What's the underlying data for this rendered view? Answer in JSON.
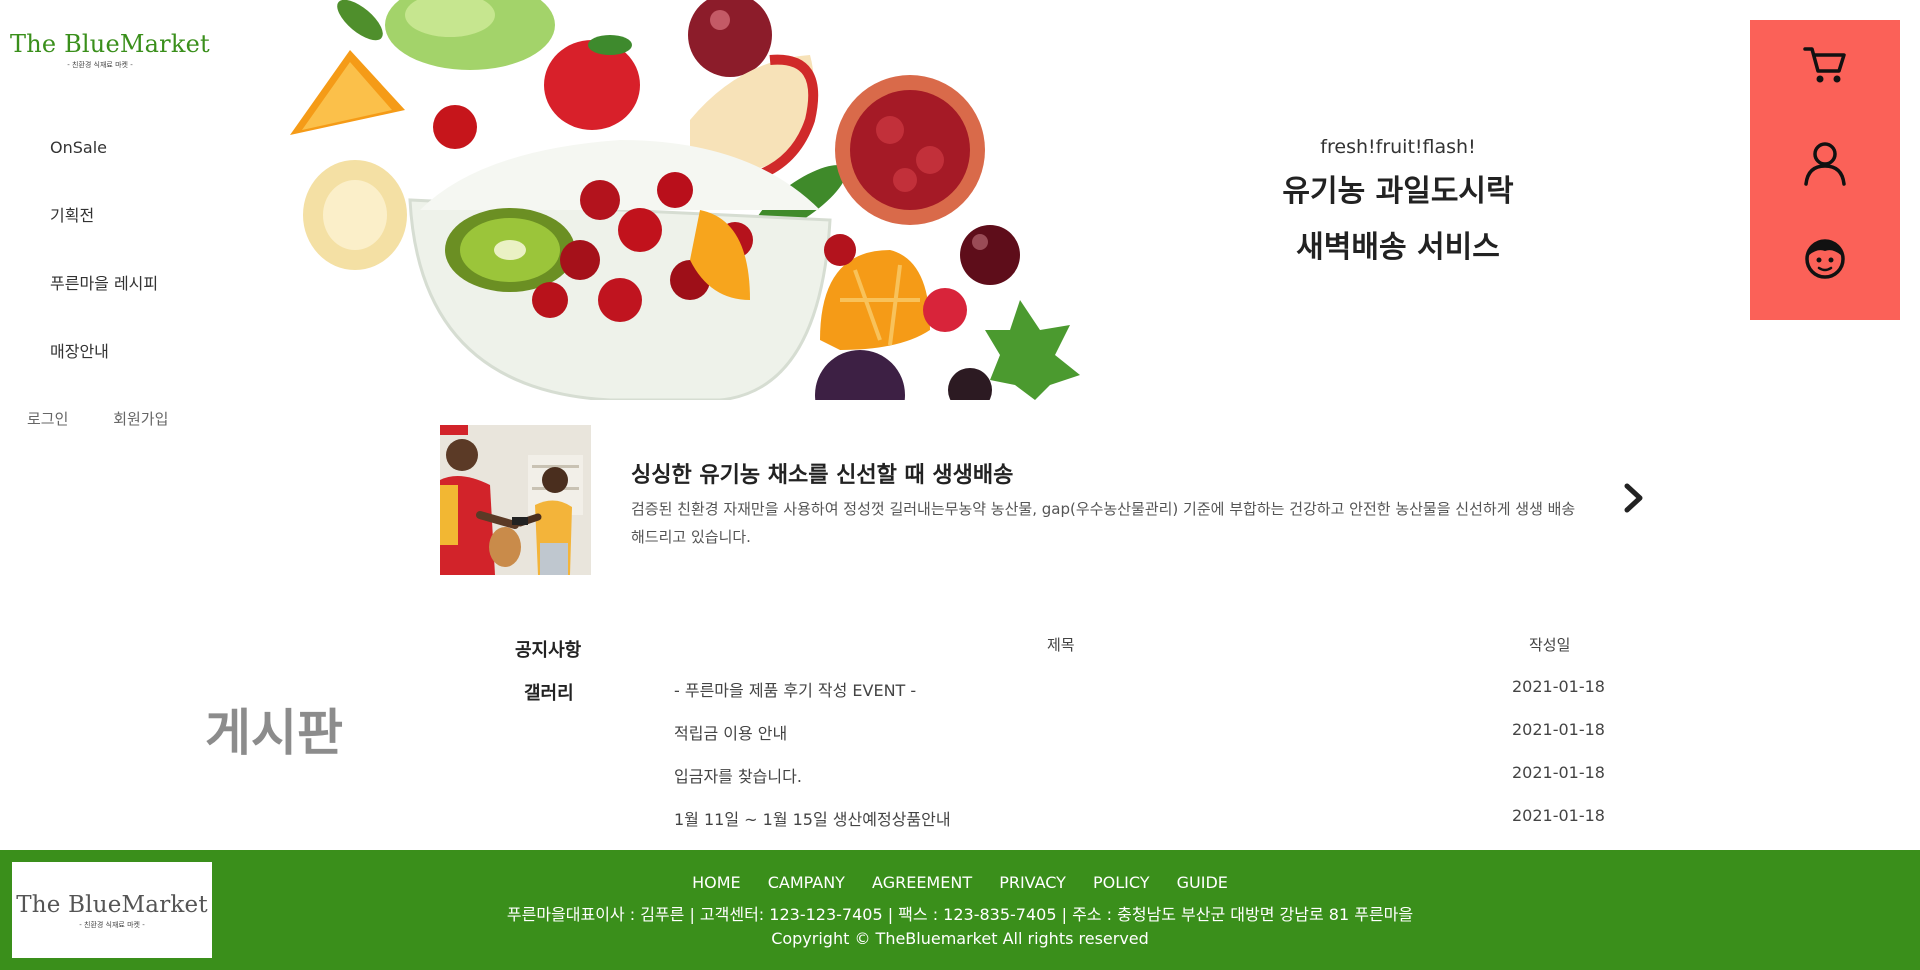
{
  "brand": {
    "name": "The BlueMarket",
    "tagline": "- 친환경 식재료 마켓 -",
    "color": "#3a8f1b"
  },
  "nav": {
    "items": [
      {
        "label": "OnSale"
      },
      {
        "label": "기획전"
      },
      {
        "label": "푸른마을 레시피"
      },
      {
        "label": "매장안내"
      }
    ]
  },
  "auth": {
    "login": "로그인",
    "signup": "회원가입"
  },
  "hero": {
    "slogan": "fresh!fruit!flash!",
    "title_line1": "유기농 과일도시락",
    "title_line2": "새벽배송 서비스"
  },
  "quick_menu": {
    "color": "#fb6158",
    "icons": [
      "cart-icon",
      "user-icon",
      "customer-service-icon"
    ]
  },
  "promo": {
    "title": "싱싱한 유기농 채소를 신선할 때 생생배송",
    "description": "검증된 친환경 자재만을 사용하여 정성껏 길러내는무농약 농산물, gap(우수농산물관리) 기준에 부합하는 건강하고 안전한 농산물을 신선하게 생생 배송 해드리고 있습니다.",
    "next_icon": "chevron-right-icon"
  },
  "board": {
    "label": "게시판",
    "tabs": [
      "공지사항",
      "갤러리"
    ],
    "columns": {
      "title": "제목",
      "date": "작성일"
    },
    "rows": [
      {
        "title": "- 푸른마을 제품 후기 작성 EVENT -",
        "date": "2021-01-18"
      },
      {
        "title": "적립금 이용 안내",
        "date": "2021-01-18"
      },
      {
        "title": "입금자를 찾습니다.",
        "date": "2021-01-18"
      },
      {
        "title": "1월 11일 ~ 1월 15일 생산예정상품안내",
        "date": "2021-01-18"
      }
    ]
  },
  "footer": {
    "color": "#3a8f1b",
    "links": [
      "HOME",
      "CAMPANY",
      "AGREEMENT",
      "PRIVACY",
      "POLICY",
      "GUIDE"
    ],
    "info": "푸른마을대표이사 : 김푸른 | 고객센터: 123-123-7405 | 팩스 : 123-835-7405 | 주소 : 충청남도 부산군 대방면 강남로 81 푸른마을",
    "copyright": "Copyright © TheBluemarket All rights reserved"
  }
}
